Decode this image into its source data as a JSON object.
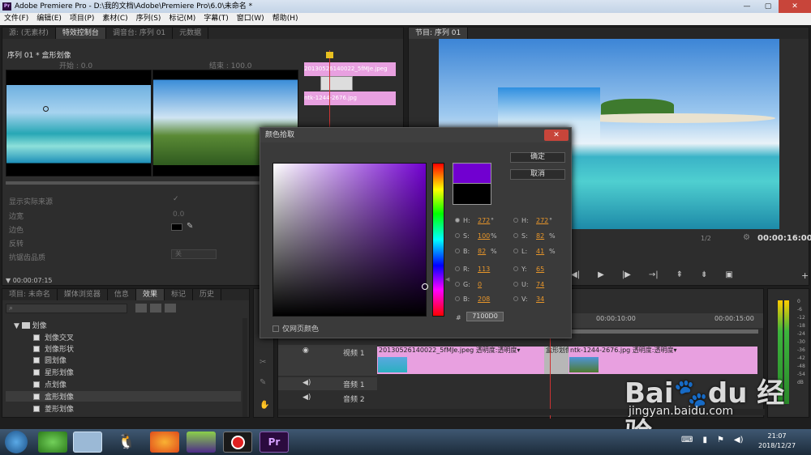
{
  "window": {
    "title": "Adobe Premiere Pro - D:\\我的文档\\Adobe\\Premiere Pro\\6.0\\未命名 *",
    "app_badge": "Pr"
  },
  "menu": [
    "文件(F)",
    "编辑(E)",
    "项目(P)",
    "素材(C)",
    "序列(S)",
    "标记(M)",
    "字幕(T)",
    "窗口(W)",
    "帮助(H)"
  ],
  "source_tabs": [
    "源: (无素材)",
    "特效控制台",
    "调音台: 序列 01",
    "元数据"
  ],
  "effect_controls": {
    "header": "序列 01 * 盒形划像",
    "start_label": "开始 : 0.0",
    "end_label": "结束 : 100.0",
    "clip_a": "20130526140022_5fMJe.jpeg",
    "clip_b": "ntk-1244-2676.jpg",
    "props": [
      {
        "label": "显示实际来源",
        "value": "✓"
      },
      {
        "label": "边宽",
        "value": "0.0"
      },
      {
        "label": "边色",
        "value": ""
      },
      {
        "label": "反转",
        "value": ""
      },
      {
        "label": "抗锯齿品质",
        "value": "关"
      }
    ],
    "timecode": "00:00:07:15"
  },
  "project_tabs": [
    "项目: 未命名",
    "媒体浏览器",
    "信息",
    "效果",
    "标记",
    "历史"
  ],
  "effects_tree": {
    "folder": "划像",
    "items": [
      "划像交叉",
      "划像形状",
      "圆划像",
      "星形划像",
      "点划像",
      "盒形划像",
      "菱形划像"
    ]
  },
  "program": {
    "tab": "节目: 序列 01",
    "zoom": "1/2",
    "timecode": "00:00:16:00"
  },
  "timeline": {
    "ruler": [
      "00:00:10:00",
      "00:00:15:00"
    ],
    "tracks": [
      {
        "name": "视频 1"
      },
      {
        "name": "音频 1"
      },
      {
        "name": "音频 2"
      }
    ],
    "clips": [
      {
        "label": "20130526140022_5fMJe.jpeg 透明度:透明度▾"
      },
      {
        "label": "盒形划像"
      },
      {
        "label": "ntk-1244-2676.jpg 透明度:透明度▾"
      }
    ]
  },
  "meter": {
    "labels": [
      "0",
      "-6",
      "-12",
      "-18",
      "-24",
      "-30",
      "-36",
      "-42",
      "-48",
      "-54",
      "dB"
    ]
  },
  "color_picker": {
    "title": "颜色拾取",
    "ok": "确定",
    "cancel": "取消",
    "hsb": [
      {
        "k": "H:",
        "v": "272",
        "u": "°"
      },
      {
        "k": "S:",
        "v": "100",
        "u": "%"
      },
      {
        "k": "B:",
        "v": "82",
        "u": "%"
      }
    ],
    "rgb": [
      {
        "k": "R:",
        "v": "113"
      },
      {
        "k": "G:",
        "v": "0"
      },
      {
        "k": "B:",
        "v": "208"
      }
    ],
    "hsl": [
      {
        "k": "H:",
        "v": "272",
        "u": "°"
      },
      {
        "k": "S:",
        "v": "82",
        "u": "%"
      },
      {
        "k": "L:",
        "v": "41",
        "u": "%"
      }
    ],
    "yuv": [
      {
        "k": "Y:",
        "v": "65"
      },
      {
        "k": "U:",
        "v": "74"
      },
      {
        "k": "V:",
        "v": "34"
      }
    ],
    "hex_label": "#",
    "hex": "7100D0",
    "web_only": "仅网页颜色",
    "new_color": "#7100d0",
    "old_color": "#000000"
  },
  "taskbar": {
    "time": "21:07",
    "date": "2018/12/27"
  },
  "watermark": {
    "logo": "Bai du 经验",
    "url": "jingyan.baidu.com"
  }
}
